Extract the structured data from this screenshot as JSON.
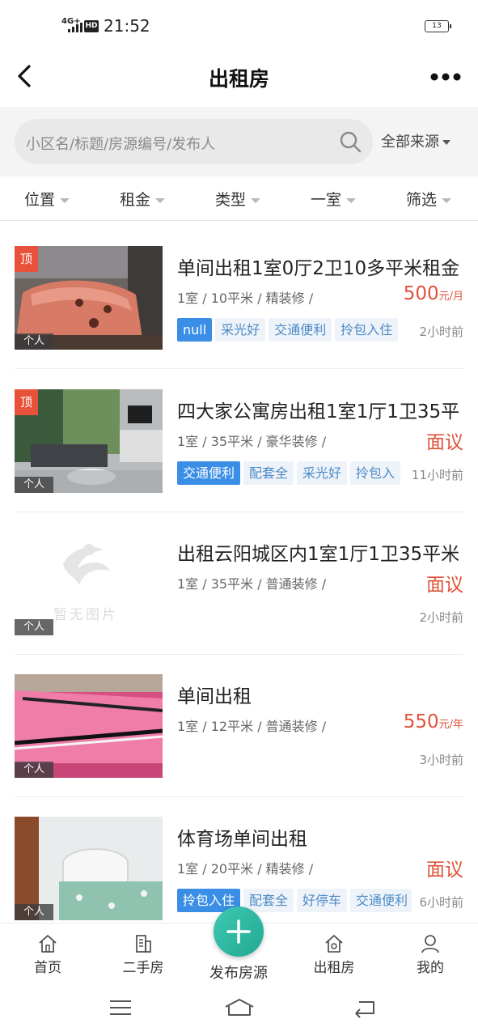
{
  "status": {
    "network": "4G+",
    "hd": "HD",
    "time": "21:52",
    "battery": "13"
  },
  "nav": {
    "title": "出租房",
    "back_icon": "chevron-left-icon",
    "more_icon": "more-dots-icon"
  },
  "search": {
    "placeholder": "小区名/标题/房源编号/发布人",
    "source_label": "全部来源"
  },
  "filters": [
    "位置",
    "租金",
    "类型",
    "一室",
    "筛选"
  ],
  "listings": [
    {
      "title": "单间出租1室0厅2卫10多平米租金",
      "meta": "1室 / 10平米 / 精装修 /",
      "price": "500",
      "price_unit": "元/月",
      "top_badge": "顶",
      "owner_badge": "个人",
      "tags": [
        "null",
        "采光好",
        "交通便利",
        "拎包入住"
      ],
      "time": "2小时前"
    },
    {
      "title": "四大家公寓房出租1室1厅1卫35平",
      "meta": "1室 / 35平米 / 豪华装修 /",
      "price": "面议",
      "price_unit": "",
      "top_badge": "顶",
      "owner_badge": "个人",
      "tags": [
        "交通便利",
        "配套全",
        "采光好",
        "拎包入"
      ],
      "time": "11小时前"
    },
    {
      "title": "出租云阳城区内1室1厅1卫35平米",
      "meta": "1室 / 35平米 / 普通装修 /",
      "price": "面议",
      "price_unit": "",
      "owner_badge": "个人",
      "placeholder_text": "暂无图片",
      "tags": [],
      "time": "2小时前"
    },
    {
      "title": "单间出租",
      "meta": "1室 / 12平米 / 普通装修 /",
      "price": "550",
      "price_unit": "元/年",
      "owner_badge": "个人",
      "tags": [],
      "time": "3小时前"
    },
    {
      "title": "体育场单间出租",
      "meta": "1室 / 20平米 / 精装修 /",
      "price": "面议",
      "price_unit": "",
      "owner_badge": "个人",
      "tags": [
        "拎包入住",
        "配套全",
        "好停车",
        "交通便利"
      ],
      "time": "6小时前"
    }
  ],
  "tabbar": {
    "home": "首页",
    "second_hand": "二手房",
    "publish": "发布房源",
    "rent": "出租房",
    "mine": "我的"
  },
  "colors": {
    "accent_red": "#e0533b",
    "tag_blue": "#3a8ee6",
    "fab_green": "#2bb8a1"
  }
}
